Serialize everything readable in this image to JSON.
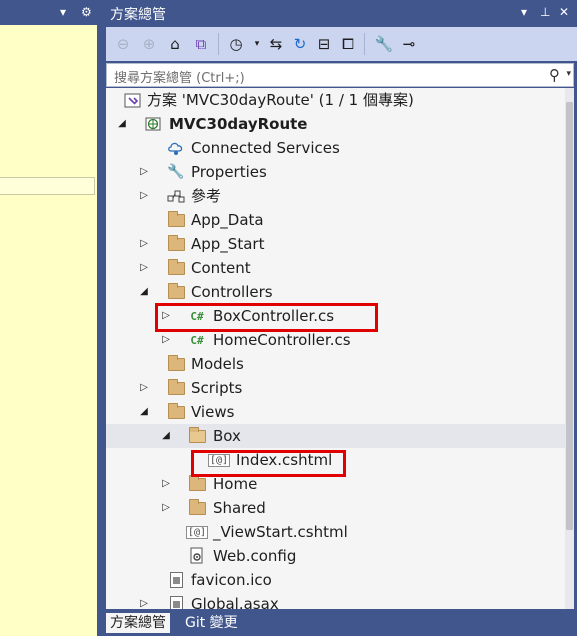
{
  "left_panel": {
    "dropdown_icon": "chevron-down-icon",
    "gear_icon": "gear-icon"
  },
  "explorer": {
    "title": "方案總管",
    "title_buttons": [
      "chevron-down-icon",
      "pin-icon",
      "close-icon"
    ],
    "toolbar": [
      "back-icon",
      "forward-icon",
      "home-icon",
      "vs-switch-views-icon",
      "history-icon",
      "chevron-down-icon",
      "sync-icon",
      "refresh-icon",
      "collapse-all-icon",
      "show-all-files-icon",
      "properties-wrench-icon",
      "preview-icon"
    ],
    "search_placeholder": "搜尋方案總管 (Ctrl+;)",
    "tree": [
      {
        "label": "方案 'MVC30dayRoute' (1 / 1 個專案)",
        "icon": "solution-icon"
      },
      {
        "label": "MVC30dayRoute",
        "icon": "web-project-icon",
        "expanded": true
      },
      {
        "label": "Connected Services",
        "icon": "connected-services-icon"
      },
      {
        "label": "Properties",
        "icon": "wrench-icon",
        "expanded": false
      },
      {
        "label": "參考",
        "icon": "references-icon",
        "expanded": false
      },
      {
        "label": "App_Data",
        "icon": "folder-icon"
      },
      {
        "label": "App_Start",
        "icon": "folder-icon",
        "expanded": false
      },
      {
        "label": "Content",
        "icon": "folder-icon",
        "expanded": false
      },
      {
        "label": "Controllers",
        "icon": "folder-icon",
        "expanded": true
      },
      {
        "label": "BoxController.cs",
        "icon": "csharp-file-icon",
        "expanded": false,
        "highlighted": true
      },
      {
        "label": "HomeController.cs",
        "icon": "csharp-file-icon",
        "expanded": false
      },
      {
        "label": "Models",
        "icon": "folder-icon"
      },
      {
        "label": "Scripts",
        "icon": "folder-icon",
        "expanded": false
      },
      {
        "label": "Views",
        "icon": "folder-icon",
        "expanded": true
      },
      {
        "label": "Box",
        "icon": "folder-open-icon",
        "expanded": true,
        "selected": true
      },
      {
        "label": "Index.cshtml",
        "icon": "razor-file-icon",
        "highlighted": true
      },
      {
        "label": "Home",
        "icon": "folder-icon",
        "expanded": false
      },
      {
        "label": "Shared",
        "icon": "folder-icon",
        "expanded": false
      },
      {
        "label": "_ViewStart.cshtml",
        "icon": "razor-file-icon"
      },
      {
        "label": "Web.config",
        "icon": "config-file-icon"
      },
      {
        "label": "favicon.ico",
        "icon": "icon-file-icon"
      },
      {
        "label": "Global.asax",
        "icon": "asax-file-icon",
        "expanded": false
      }
    ],
    "tabs": [
      "方案總管",
      "Git 變更"
    ],
    "highlight_color": "#e00000"
  }
}
